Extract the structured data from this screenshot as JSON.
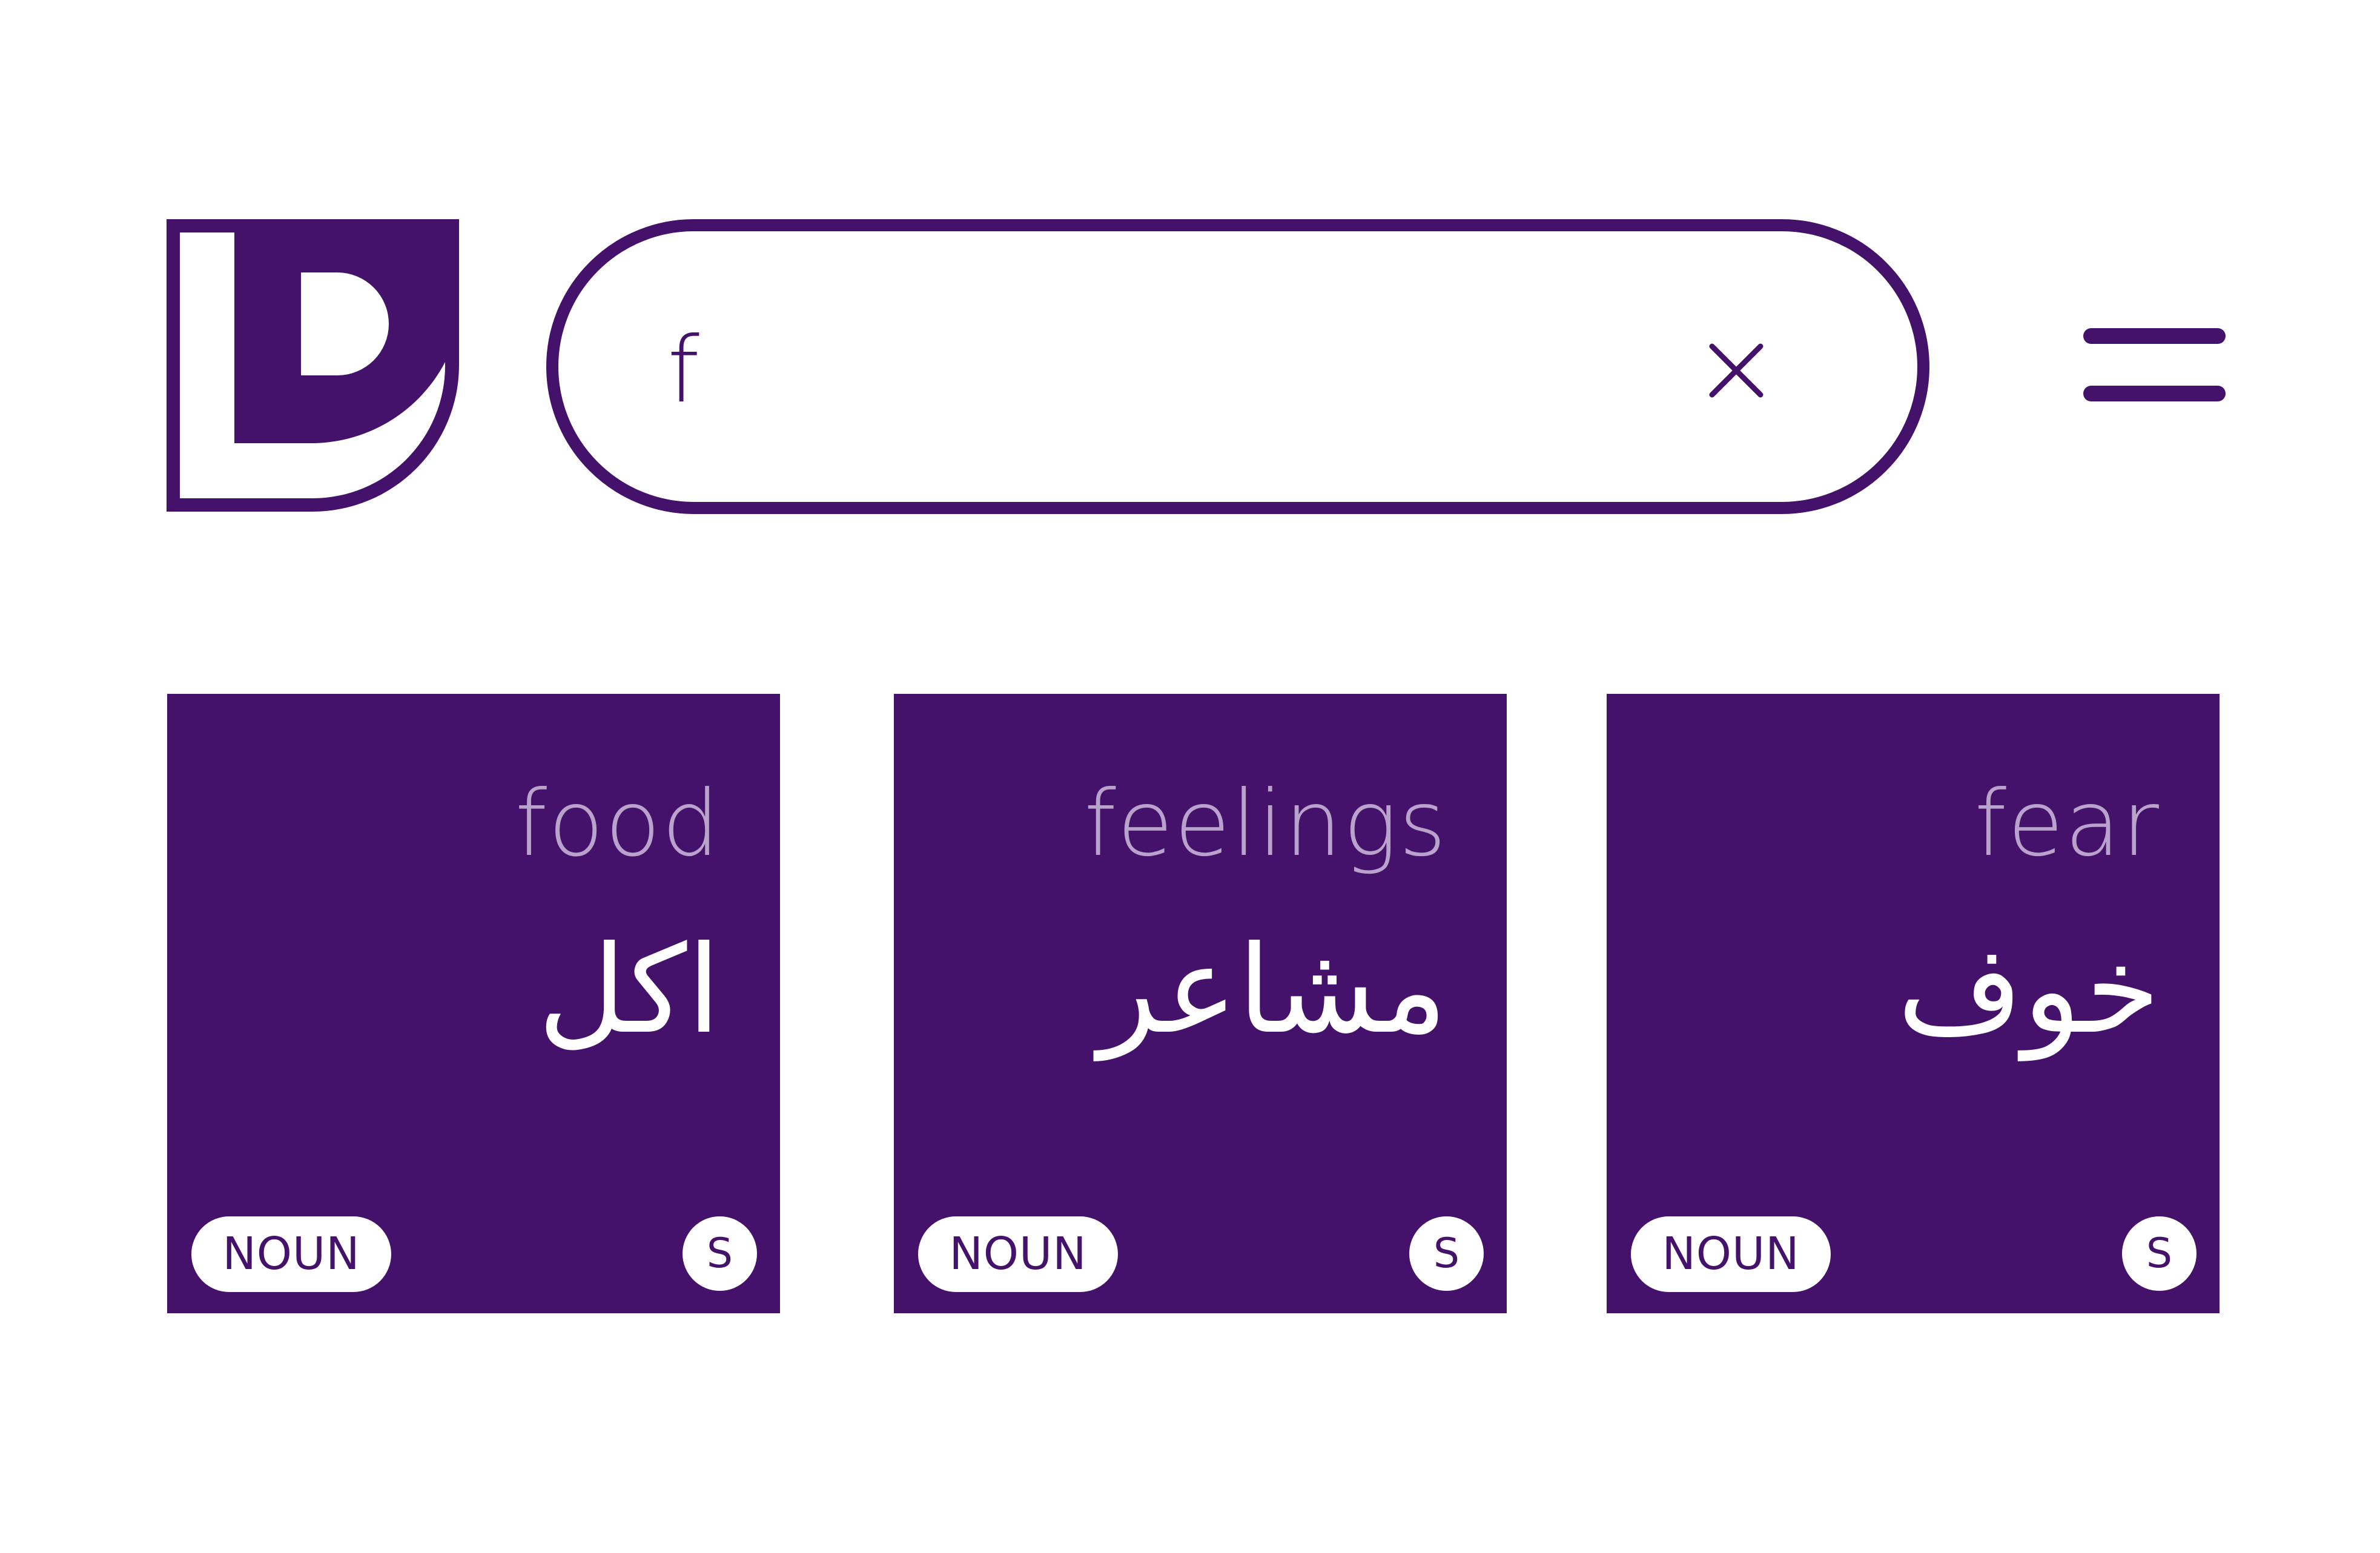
{
  "app": {
    "logo_icon": "ld-logo-icon",
    "brand_color": "#44126b",
    "english_label_color": "#b9a3cd"
  },
  "search": {
    "value": "f",
    "clear_icon": "close-icon"
  },
  "menu": {
    "icon": "menu-icon"
  },
  "results": [
    {
      "english": "food",
      "arabic": "اكل",
      "pos": "NOUN",
      "badge": "S"
    },
    {
      "english": "feelings",
      "arabic": "مشاعر",
      "pos": "NOUN",
      "badge": "S"
    },
    {
      "english": "fear",
      "arabic": "خوف",
      "pos": "NOUN",
      "badge": "S"
    }
  ]
}
